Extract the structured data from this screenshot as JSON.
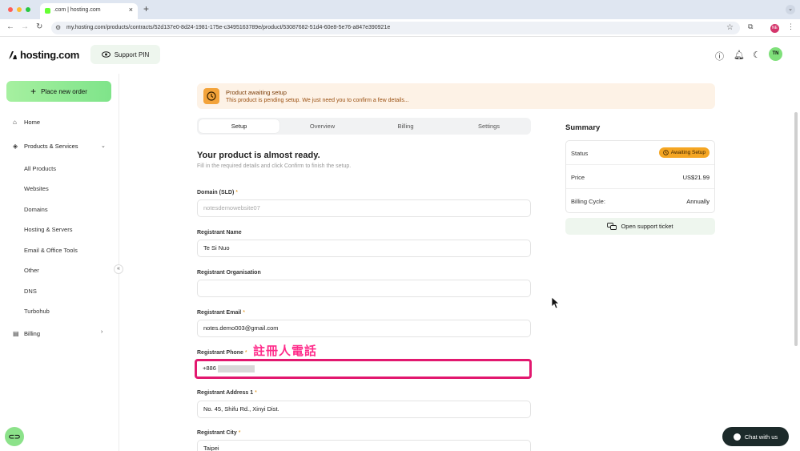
{
  "browser": {
    "tab_title": ".com | hosting.com",
    "new_tab": "+",
    "url": "my.hosting.com/products/contracts/52d137e0-8d24-1981-175e-c3495163789e/product/53087682-51d4-60e8-5e76-a847e390921e",
    "profile": "NE"
  },
  "header": {
    "logo_text": "hosting.com",
    "support_pin": "Support PIN",
    "avatar": "TN"
  },
  "sidebar": {
    "place_order": "Place new order",
    "home": "Home",
    "products_services": "Products & Services",
    "items": [
      "All Products",
      "Websites",
      "Domains",
      "Hosting & Servers",
      "Email & Office Tools",
      "Other",
      "DNS",
      "Turbohub"
    ],
    "billing": "Billing"
  },
  "alert": {
    "title": "Product awaiting setup",
    "desc": "This product is pending setup. We just need you to confirm a few details..."
  },
  "tabs": [
    "Setup",
    "Overview",
    "Billing",
    "Settings"
  ],
  "main": {
    "heading": "Your product is almost ready.",
    "subheading": "Fill in the required details and click Confirm to finish the setup."
  },
  "fields": {
    "domain": {
      "label": "Domain (SLD)",
      "required": "*",
      "placeholder": "notesdemowebsite07"
    },
    "name": {
      "label": "Registrant Name",
      "value": "Te Si Nuo"
    },
    "org": {
      "label": "Registrant Organisation",
      "value": ""
    },
    "email": {
      "label": "Registrant Email",
      "required": "*",
      "value": "notes.demo003@gmail.com"
    },
    "phone": {
      "label": "Registrant Phone",
      "required": "*",
      "value": "+886"
    },
    "address": {
      "label": "Registrant Address 1",
      "required": "*",
      "value": "No. 45, Shifu Rd., Xinyi Dist."
    },
    "city": {
      "label": "Registrant City",
      "required": "*",
      "value": "Taipei"
    }
  },
  "annotation": "註冊人電話",
  "summary": {
    "title": "Summary",
    "status_label": "Status",
    "status_value": "Awaiting Setup",
    "price_label": "Price",
    "price_value": "US$21.99",
    "cycle_label": "Billing Cycle:",
    "cycle_value": "Annually",
    "support": "Open support ticket"
  },
  "chat": "Chat with us",
  "colors": {
    "accent_green": "#7fe48a",
    "alert_orange": "#f3a33a",
    "annotation_pink": "#e2186f"
  }
}
